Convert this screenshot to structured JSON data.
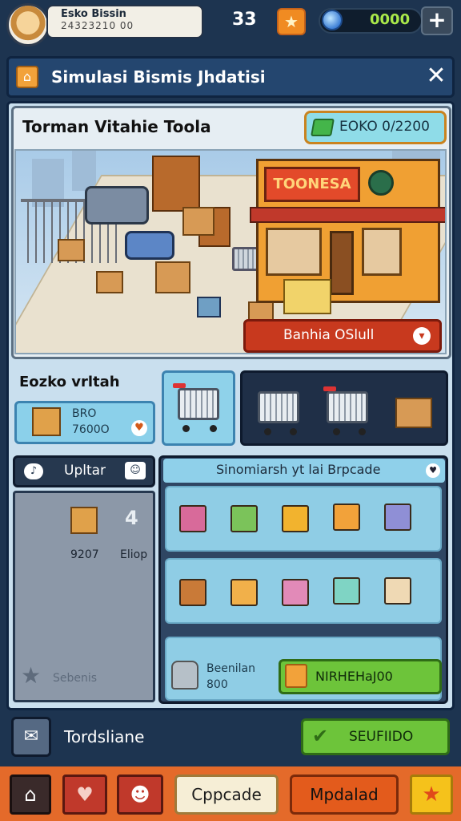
{
  "header": {
    "profile_name": "Esko Bissin",
    "profile_sub": "24323210 00",
    "level": "33",
    "gems": "0000",
    "plus": "+"
  },
  "title_bar": {
    "title": "Simulasi Bismis Jhdatisi",
    "close": "✕"
  },
  "store": {
    "title": "Torman Vitahie Toola",
    "badge": "EOKO 0/2200",
    "sign": "TOONESA",
    "buy_label": "Banhia OSlull"
  },
  "category": {
    "label": "Eozko vrltah",
    "item_name": "BRO",
    "item_price": "7600O"
  },
  "side_panel": {
    "head": "Upltar",
    "count": "4",
    "price": "9207",
    "shop": "Eliop",
    "footer": "Sebenis"
  },
  "right_panel": {
    "head": "Sinomiarsh yt lai Brpcade",
    "row3_name": "Beenilan",
    "row3_sub": "800",
    "green_button": "NIRHEHaJ00"
  },
  "bottom_bar": {
    "label": "Tordsliane",
    "select": "SEUFIIDO"
  },
  "nav": {
    "home": "⌂",
    "heart": "♥",
    "face": "☻",
    "mid": "Cppcade",
    "update": "Mpdalad",
    "star": "★"
  },
  "colors": {
    "accent_orange": "#f08b22",
    "green": "#6dc43a",
    "red": "#c8391e",
    "dark_blue": "#1d3450"
  }
}
